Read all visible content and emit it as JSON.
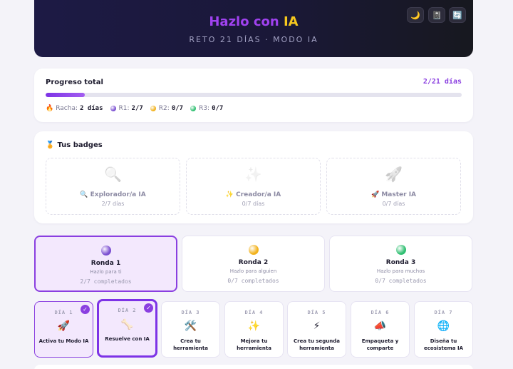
{
  "header": {
    "title_part1": "Hazlo con",
    "title_part2": "IA",
    "subtitle": "RETO 21 DÍAS · MODO IA",
    "buttons": [
      {
        "icon": "moon-icon",
        "glyph": "🌙"
      },
      {
        "icon": "notebook-icon",
        "glyph": "📓"
      },
      {
        "icon": "refresh-icon",
        "glyph": "🔄"
      }
    ]
  },
  "progress": {
    "title": "Progreso total",
    "days": "2/21 días",
    "fraction": 0.095,
    "streak_label": "Racha:",
    "streak_value": "2 días",
    "rounds": [
      {
        "label": "R1:",
        "value": "2/7",
        "color": "#7b4fd1"
      },
      {
        "label": "R2:",
        "value": "0/7",
        "color": "#f2b21c"
      },
      {
        "label": "R3:",
        "value": "0/7",
        "color": "#2fbf71"
      }
    ]
  },
  "badges": {
    "title": "Tus badges",
    "items": [
      {
        "icon": "magnifier-icon",
        "glyph": "🔍",
        "name": "Explorador/a IA",
        "progress": "2/7 días"
      },
      {
        "icon": "sparkles-icon",
        "glyph": "✨",
        "name": "Creador/a IA",
        "progress": "0/7 días"
      },
      {
        "icon": "rocket-icon",
        "glyph": "🚀",
        "name": "Master IA",
        "progress": "0/7 días"
      }
    ]
  },
  "rounds": [
    {
      "name": "Ronda 1",
      "subtitle": "Hazlo para ti",
      "progress": "2/7 completados",
      "color": "#7b4fd1",
      "active": true
    },
    {
      "name": "Ronda 2",
      "subtitle": "Hazlo para alguien",
      "progress": "0/7 completados",
      "color": "#f2b21c",
      "active": false
    },
    {
      "name": "Ronda 3",
      "subtitle": "Hazlo para muchos",
      "progress": "0/7 completados",
      "color": "#2fbf71",
      "active": false
    }
  ],
  "days": [
    {
      "label": "DÍA 1",
      "glyph": "🚀",
      "icon": "rocket-icon",
      "name": "Activa tu Modo IA",
      "state": "done"
    },
    {
      "label": "DÍA 2",
      "glyph": "🦴",
      "icon": "bone-icon",
      "name": "Resuelve con IA",
      "state": "current"
    },
    {
      "label": "DÍA 3",
      "glyph": "🛠️",
      "icon": "tools-icon",
      "name": "Crea tu herramienta",
      "state": "todo"
    },
    {
      "label": "DÍA 4",
      "glyph": "✨",
      "icon": "sparkles-icon",
      "name": "Mejora tu herramienta",
      "state": "todo"
    },
    {
      "label": "DÍA 5",
      "glyph": "⚡",
      "icon": "lightning-icon",
      "name": "Crea tu segunda herramienta",
      "state": "todo"
    },
    {
      "label": "DÍA 6",
      "glyph": "📣",
      "icon": "megaphone-icon",
      "name": "Empaqueta y comparte",
      "state": "todo"
    },
    {
      "label": "DÍA 7",
      "glyph": "🌐",
      "icon": "globe-icon",
      "name": "Diseña tu ecosistema IA",
      "state": "todo"
    }
  ]
}
